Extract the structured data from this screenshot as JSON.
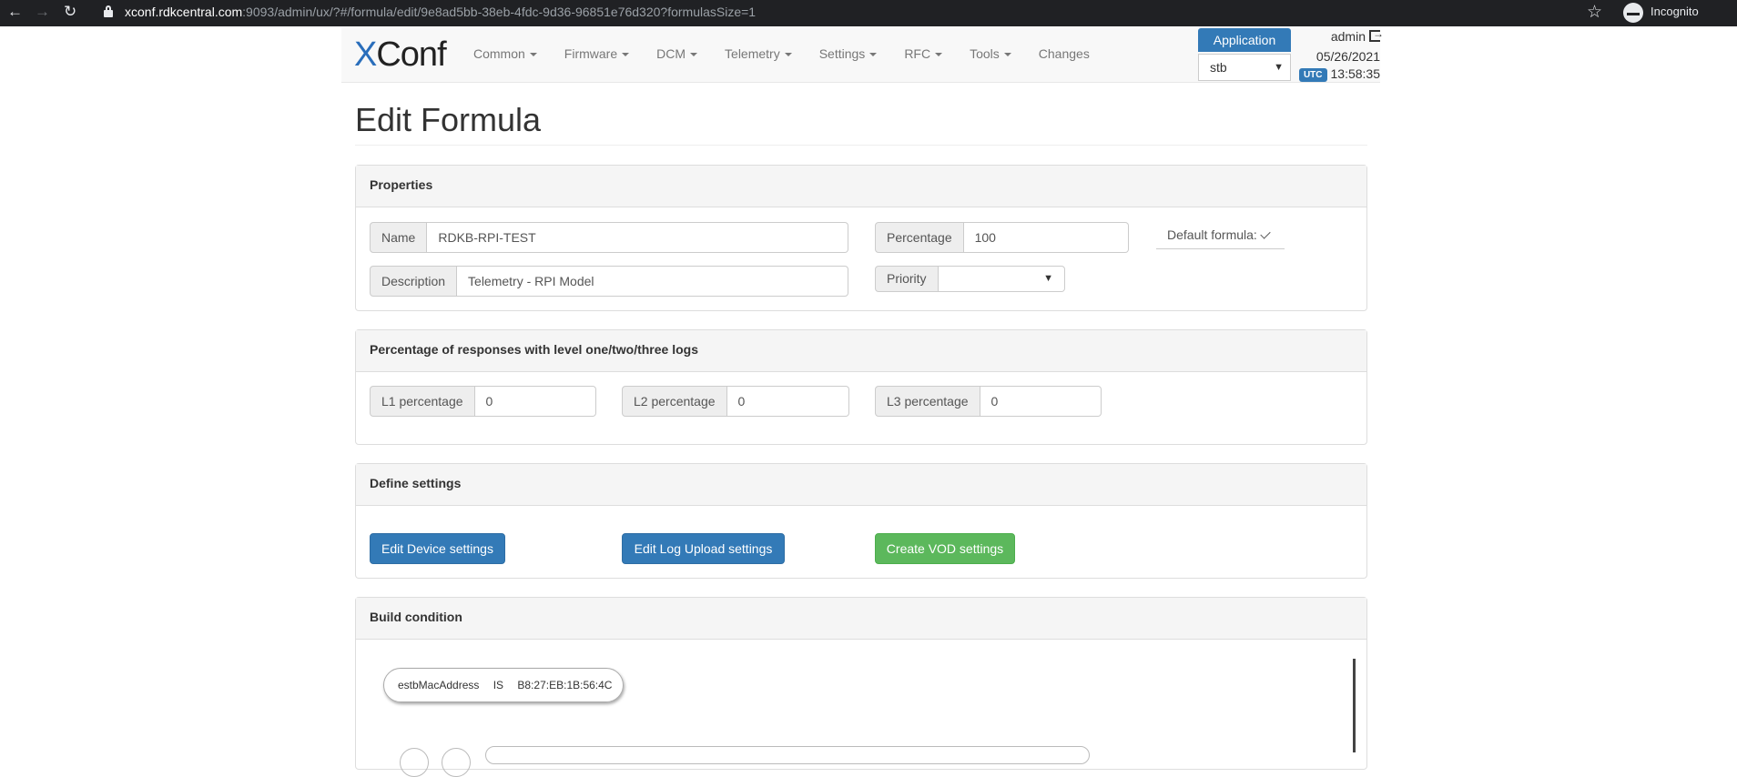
{
  "browser": {
    "url_host": "xconf.rdkcentral.com",
    "url_rest": ":9093/admin/ux/?#/formula/edit/9e8ad5bb-38eb-4fdc-9d36-96851e76d320?formulasSize=1",
    "profile_label": "Incognito"
  },
  "navbar": {
    "brand_x": "X",
    "brand_rest": "Conf",
    "menu": [
      {
        "label": "Common"
      },
      {
        "label": "Firmware"
      },
      {
        "label": "DCM"
      },
      {
        "label": "Telemetry"
      },
      {
        "label": "Settings"
      },
      {
        "label": "RFC"
      },
      {
        "label": "Tools"
      },
      {
        "label": "Changes"
      }
    ],
    "application_label": "Application",
    "application_value": "stb",
    "user": "admin",
    "date": "05/26/2021",
    "tz_badge": "UTC",
    "time": "13:58:35"
  },
  "page": {
    "title": "Edit Formula"
  },
  "properties": {
    "heading": "Properties",
    "name_label": "Name",
    "name_value": "RDKB-RPI-TEST",
    "description_label": "Description",
    "description_value": "Telemetry - RPI Model",
    "percentage_label": "Percentage",
    "percentage_value": "100",
    "priority_label": "Priority",
    "priority_value": "",
    "default_formula_label": "Default formula:"
  },
  "levels": {
    "heading": "Percentage of responses with level one/two/three logs",
    "l1_label": "L1 percentage",
    "l1_value": "0",
    "l2_label": "L2 percentage",
    "l2_value": "0",
    "l3_label": "L3 percentage",
    "l3_value": "0"
  },
  "settings": {
    "heading": "Define settings",
    "edit_device_label": "Edit Device settings",
    "edit_log_upload_label": "Edit Log Upload settings",
    "create_vod_label": "Create VOD settings"
  },
  "condition": {
    "heading": "Build condition",
    "free_arg": "estbMacAddress",
    "operation": "IS",
    "fixed_arg": "B8:27:EB:1B:56:4C"
  }
}
